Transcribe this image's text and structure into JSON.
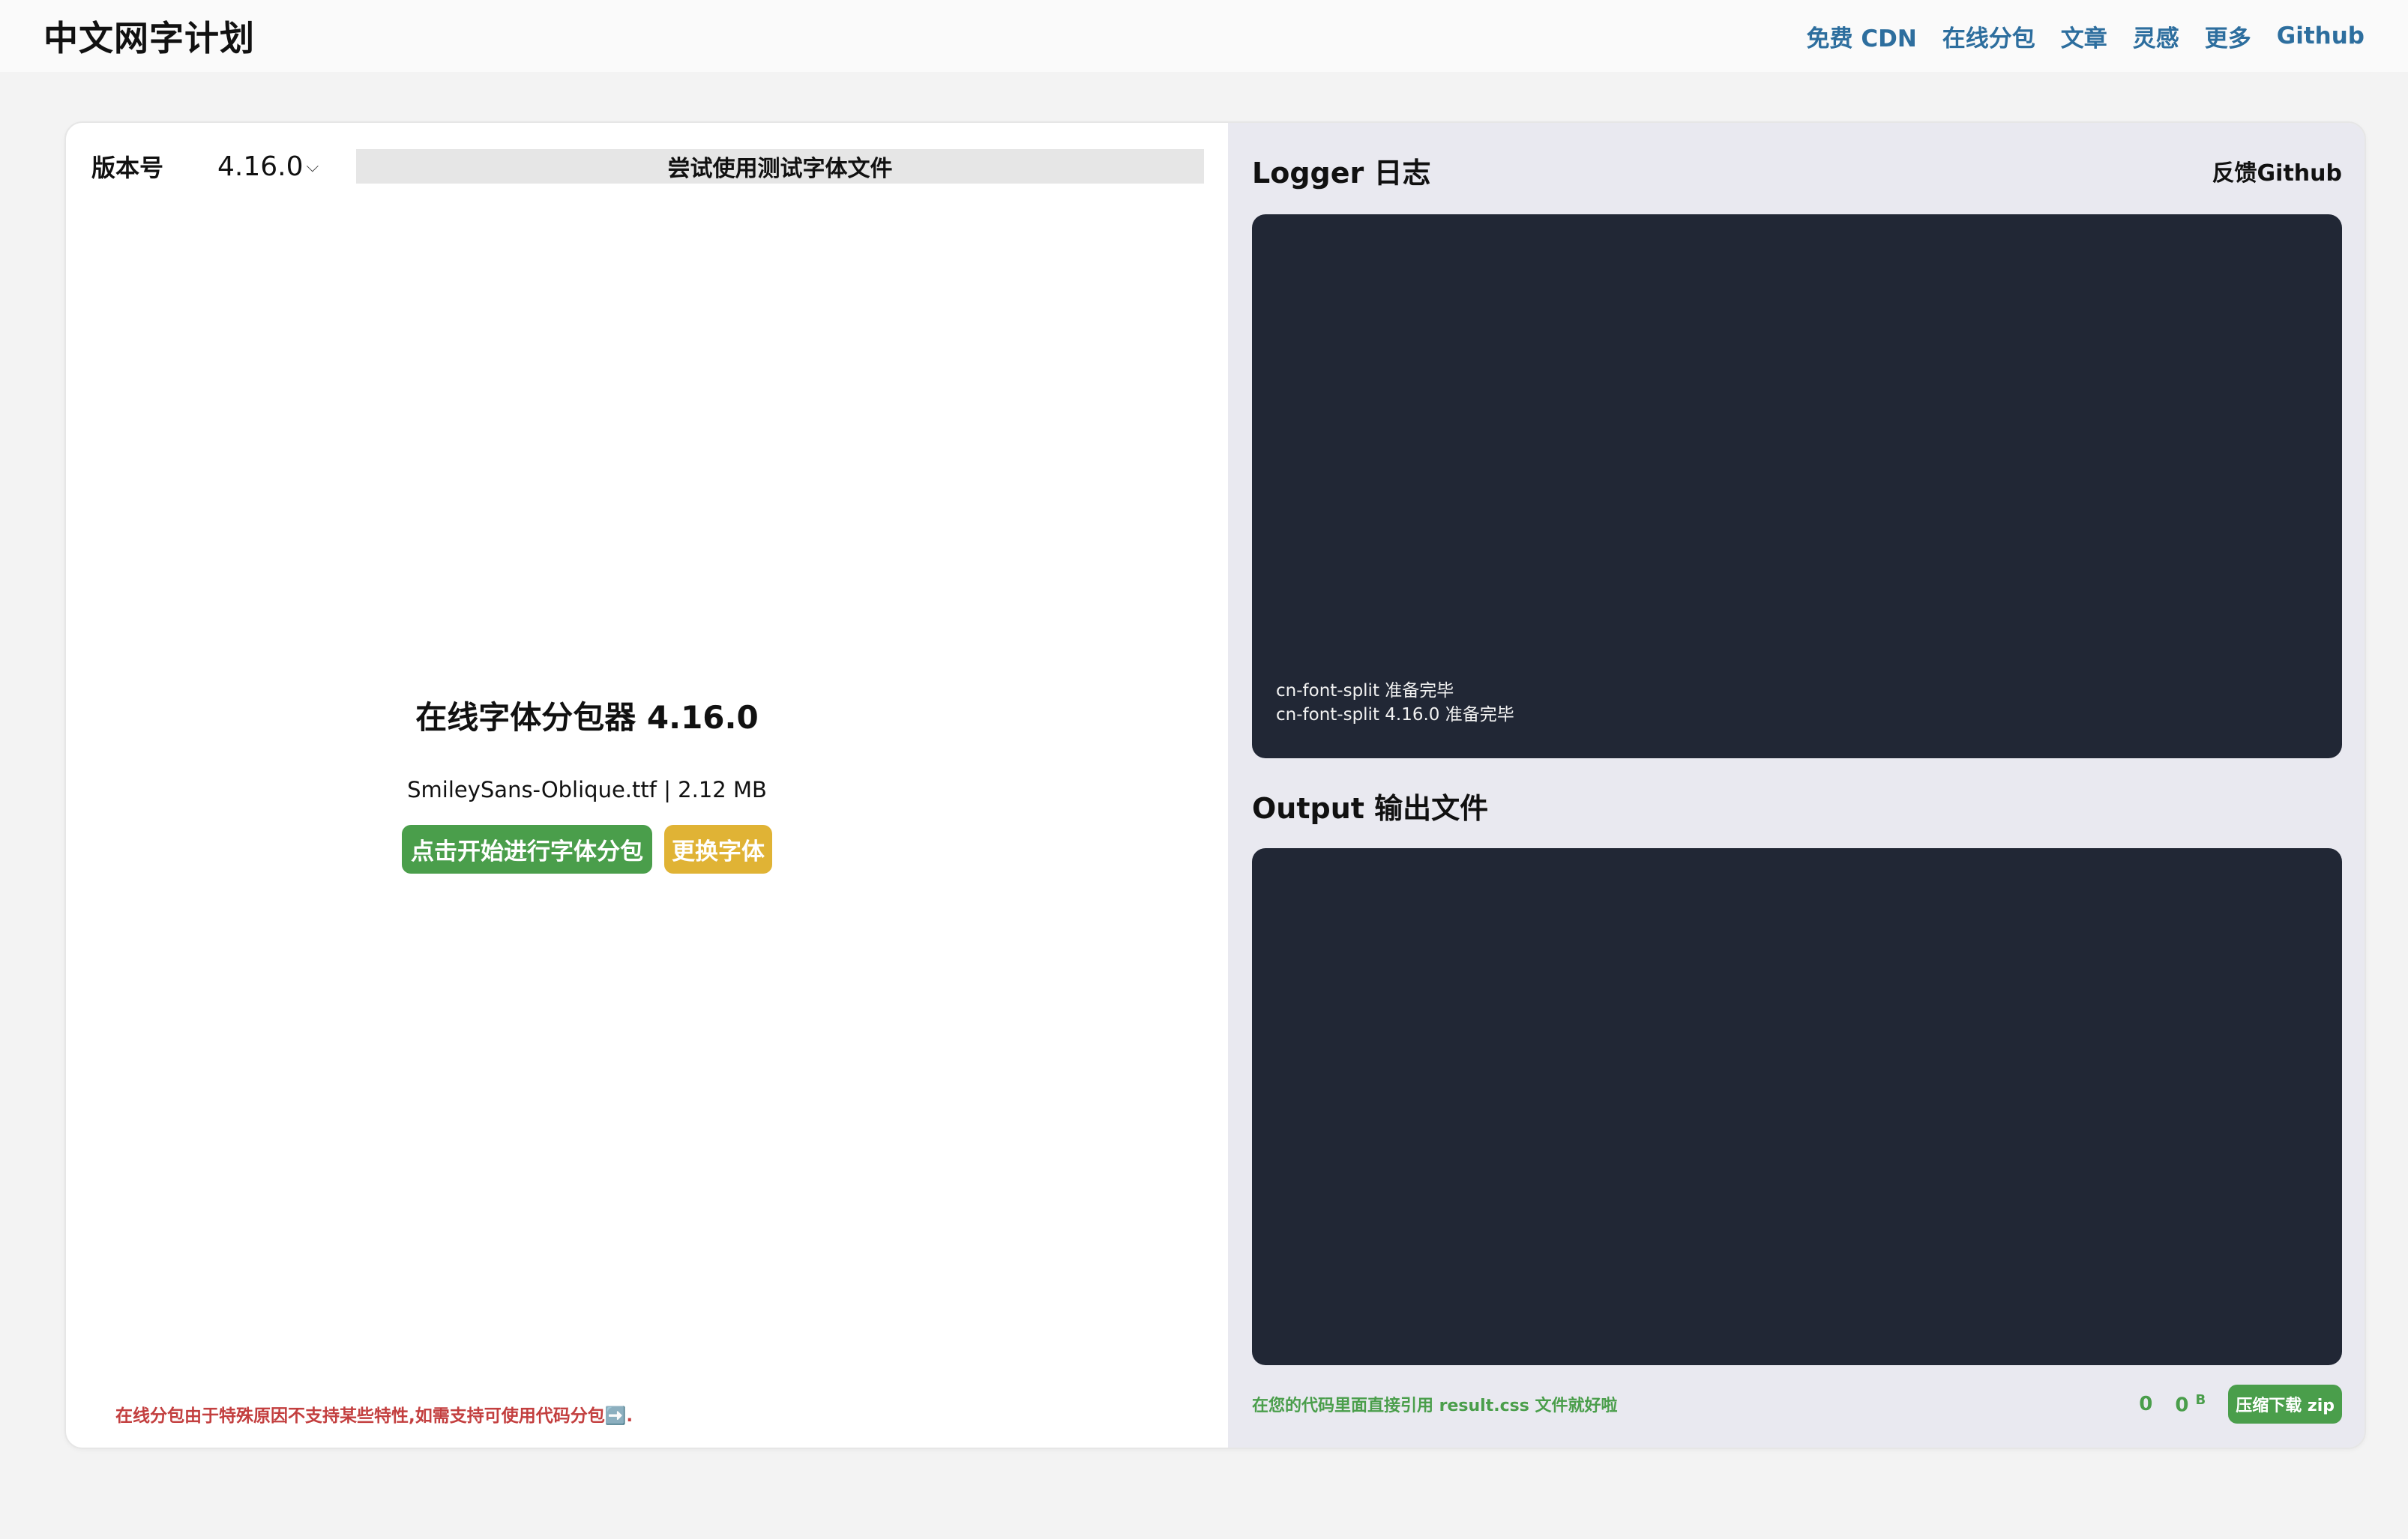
{
  "header": {
    "brand": "中文网字计划",
    "nav": [
      "免费 CDN",
      "在线分包",
      "文章",
      "灵感",
      "更多",
      "Github"
    ]
  },
  "left": {
    "version_label": "版本号",
    "version_value": "4.16.0",
    "try_button": "尝试使用测试字体文件",
    "title": "在线字体分包器 4.16.0",
    "file_info": "SmileySans-Oblique.ttf | 2.12 MB",
    "start_button": "点击开始进行字体分包",
    "change_button": "更换字体",
    "notice": "在线分包由于特殊原因不支持某些特性,如需支持可使用代码分包➡️."
  },
  "right": {
    "logger_title": "Logger 日志",
    "feedback_link": "反馈Github",
    "log_lines": [
      "cn-font-split 准备完毕",
      "cn-font-split 4.16.0 准备完毕"
    ],
    "output_title": "Output 输出文件",
    "hint": "在您的代码里面直接引用 result.css 文件就好啦",
    "file_count": "0",
    "total_size": "0",
    "size_unit": "B",
    "zip_button": "压缩下载 zip"
  }
}
